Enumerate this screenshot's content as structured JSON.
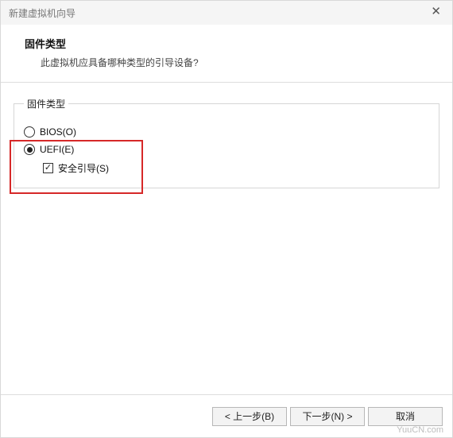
{
  "titlebar": {
    "title": "新建虚拟机向导"
  },
  "header": {
    "heading": "固件类型",
    "subtitle": "此虚拟机应具备哪种类型的引导设备?"
  },
  "fieldset": {
    "legend": "固件类型"
  },
  "options": {
    "bios": {
      "label": "BIOS(O)",
      "selected": false
    },
    "uefi": {
      "label": "UEFI(E)",
      "selected": true
    },
    "secure_boot": {
      "label": "安全引导(S)",
      "checked": true
    }
  },
  "footer": {
    "back": "< 上一步(B)",
    "next": "下一步(N) >",
    "cancel": "取消"
  },
  "watermark": "YuuCN.com"
}
